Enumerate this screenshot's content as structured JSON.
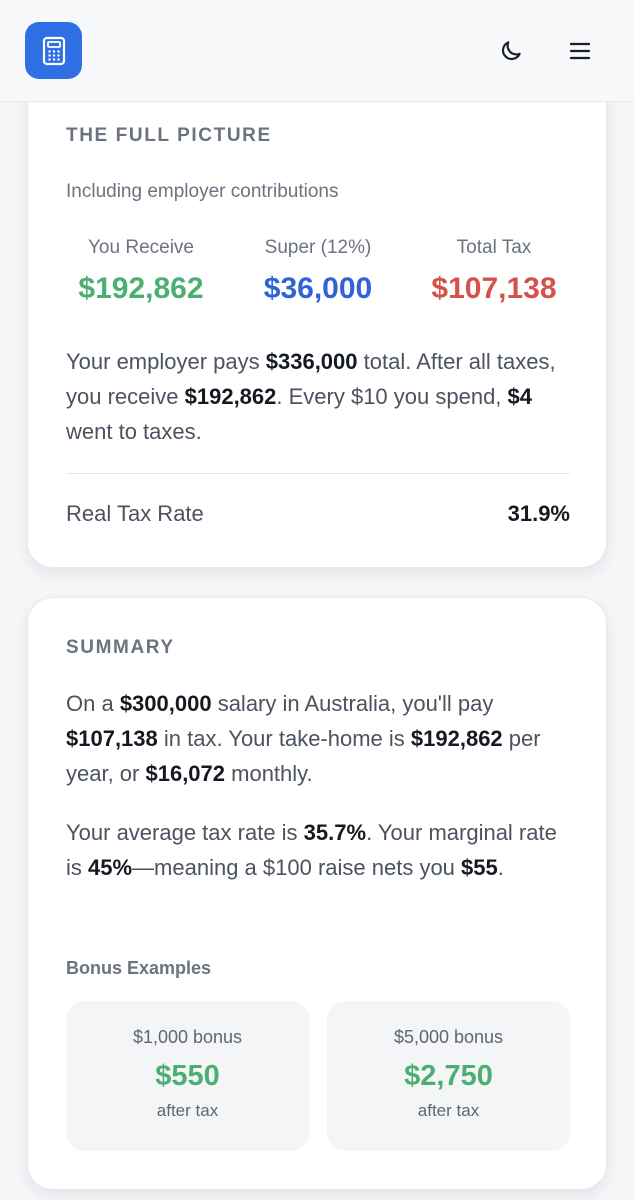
{
  "colors": {
    "brand": "#2f6fe4",
    "green": "#4caf72",
    "blue": "#2f63d8",
    "red": "#d3534a"
  },
  "header": {
    "logo_icon": "calculator-icon",
    "theme_icon": "moon-icon",
    "menu_icon": "hamburger-menu-icon"
  },
  "full_picture": {
    "title": "THE FULL PICTURE",
    "subtitle": "Including employer contributions",
    "stats": [
      {
        "label": "You Receive",
        "value": "$192,862",
        "color": "#4caf72"
      },
      {
        "label": "Super (12%)",
        "value": "$36,000",
        "color": "#2f63d8"
      },
      {
        "label": "Total Tax",
        "value": "$107,138",
        "color": "#d3534a"
      }
    ],
    "description": {
      "p1": "Your employer pays ",
      "b1": "$336,000",
      "p2": " total. After all taxes, you receive ",
      "b2": "$192,862",
      "p3": ". Every $10 you spend, ",
      "b3": "$4",
      "p4": " went to taxes."
    },
    "real_tax_rate_label": "Real Tax Rate",
    "real_tax_rate_value": "31.9%"
  },
  "summary": {
    "title": "SUMMARY",
    "para1": {
      "p1": "On a ",
      "b1": "$300,000",
      "p2": " salary in Australia, you'll pay ",
      "b2": "$107,138",
      "p3": " in tax. Your take-home is ",
      "b3": "$192,862",
      "p4": " per year, or ",
      "b4": "$16,072",
      "p5": " monthly."
    },
    "para2": {
      "p1": "Your average tax rate is ",
      "b1": "35.7%",
      "p2": ". Your marginal rate is ",
      "b2": "45%",
      "p3": "—meaning a $100 raise nets you ",
      "b3": "$55",
      "p4": "."
    },
    "bonus_title": "Bonus Examples",
    "bonuses": [
      {
        "label": "$1,000 bonus",
        "value": "$550",
        "sub": "after tax"
      },
      {
        "label": "$5,000 bonus",
        "value": "$2,750",
        "sub": "after tax"
      }
    ]
  }
}
